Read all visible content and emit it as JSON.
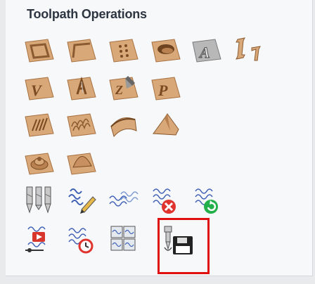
{
  "panel": {
    "title": "Toolpath Operations"
  },
  "colors": {
    "tile": "#d8a878",
    "tile_dark": "#a87040",
    "tile_light": "#ecc8a0",
    "squiggle": "#3d5fb5",
    "delete": "#e0342e",
    "recalc": "#23b04a",
    "preview": "#d8352c",
    "highlight": "#e01010"
  },
  "rows": [
    [
      "profile-toolpath-icon",
      "pocket-toolpath-icon",
      "drilling-toolpath-icon",
      "3d-pocket-toolpath-icon",
      "vcarve-text-toolpath-icon",
      "inlay-toolpath-icon"
    ],
    [
      "vcarve-toolpath-icon",
      "quick-engrave-toolpath-icon",
      "fluting-toolpath-icon",
      "prism-carve-toolpath-icon"
    ],
    [
      "texture-toolpath-icon",
      "wave-texture-toolpath-icon",
      "molding-toolpath-icon",
      "3d-roughing-toolpath-icon"
    ],
    [
      "3d-finishing-toolpath-icon",
      "3d-profile-toolpath-icon"
    ],
    [
      "tool-database-icon",
      "edit-toolpath-icon",
      "duplicate-toolpath-icon",
      "delete-toolpath-icon",
      "recalculate-toolpath-icon"
    ],
    [
      "preview-toolpath-icon",
      "toolpath-time-icon",
      "merge-toolpaths-icon",
      "save-toolpath-icon"
    ]
  ]
}
